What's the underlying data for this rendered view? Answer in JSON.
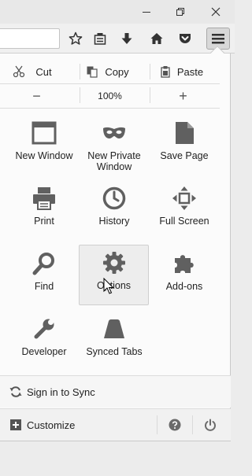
{
  "edit": {
    "cut_label": "Cut",
    "copy_label": "Copy",
    "paste_label": "Paste"
  },
  "zoom": {
    "out_symbol": "−",
    "level": "100%",
    "in_symbol": "+"
  },
  "grid": {
    "new_window": "New Window",
    "new_private_window": "New Private Window",
    "save_page": "Save Page",
    "print": "Print",
    "history": "History",
    "full_screen": "Full Screen",
    "find": "Find",
    "options": "Options",
    "add_ons": "Add-ons",
    "developer": "Developer",
    "synced_tabs": "Synced Tabs"
  },
  "footer": {
    "sign_in_label": "Sign in to Sync",
    "customize_label": "Customize"
  },
  "icons": {
    "titlebar": [
      "minimize-icon",
      "restore-icon",
      "close-icon"
    ],
    "toolbar": [
      "bookmark-star-icon",
      "reading-list-icon",
      "downloads-icon",
      "home-icon",
      "pocket-icon",
      "hamburger-menu-icon"
    ],
    "footer": [
      "sync-icon",
      "customize-plus-icon",
      "help-icon",
      "quit-power-icon"
    ]
  },
  "colors": {
    "icon_gray": "#6a6a6a",
    "panel_bg": "#fbfbfb",
    "hover_bg": "#ededed"
  }
}
